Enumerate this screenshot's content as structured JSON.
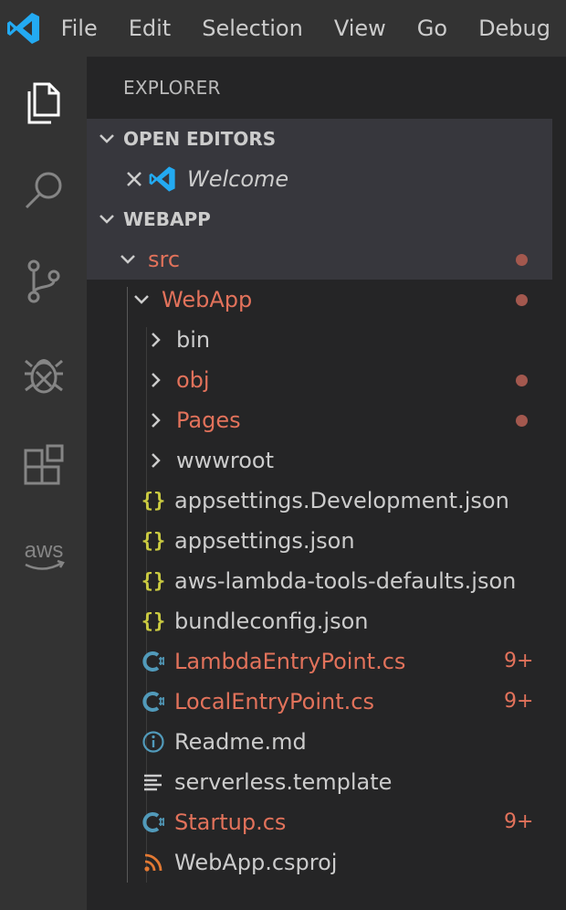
{
  "menu": {
    "items": [
      "File",
      "Edit",
      "Selection",
      "View",
      "Go",
      "Debug"
    ]
  },
  "activity": {
    "items": [
      "explorer-icon",
      "search-icon",
      "source-control-icon",
      "debug-icon",
      "extensions-icon"
    ],
    "aws_label": "aws"
  },
  "explorer": {
    "title": "EXPLORER",
    "open_editors": {
      "label": "OPEN EDITORS",
      "item": "Welcome"
    },
    "workspace": {
      "label": "WEBAPP"
    },
    "tree": [
      {
        "label": "src",
        "type": "folder",
        "open": true,
        "modified": true,
        "dot": true
      },
      {
        "label": "WebApp",
        "type": "folder",
        "open": true,
        "modified": true,
        "dot": true
      },
      {
        "label": "bin",
        "type": "folder",
        "open": false,
        "modified": false
      },
      {
        "label": "obj",
        "type": "folder",
        "open": false,
        "modified": true,
        "dot": true
      },
      {
        "label": "Pages",
        "type": "folder",
        "open": false,
        "modified": true,
        "dot": true
      },
      {
        "label": "wwwroot",
        "type": "folder",
        "open": false,
        "modified": false
      },
      {
        "label": "appsettings.Development.json",
        "type": "json"
      },
      {
        "label": "appsettings.json",
        "type": "json"
      },
      {
        "label": "aws-lambda-tools-defaults.json",
        "type": "json"
      },
      {
        "label": "bundleconfig.json",
        "type": "json"
      },
      {
        "label": "LambdaEntryPoint.cs",
        "type": "cs",
        "modified": true,
        "badge": "9+"
      },
      {
        "label": "LocalEntryPoint.cs",
        "type": "cs",
        "modified": true,
        "badge": "9+"
      },
      {
        "label": "Readme.md",
        "type": "info"
      },
      {
        "label": "serverless.template",
        "type": "lines"
      },
      {
        "label": "Startup.cs",
        "type": "cs",
        "modified": true,
        "badge": "9+"
      },
      {
        "label": "WebApp.csproj",
        "type": "rss"
      }
    ]
  },
  "colors": {
    "accent": "#23aaf2",
    "modified": "#e2725b",
    "json": "#cbcb41",
    "dot": "#a3584e"
  }
}
